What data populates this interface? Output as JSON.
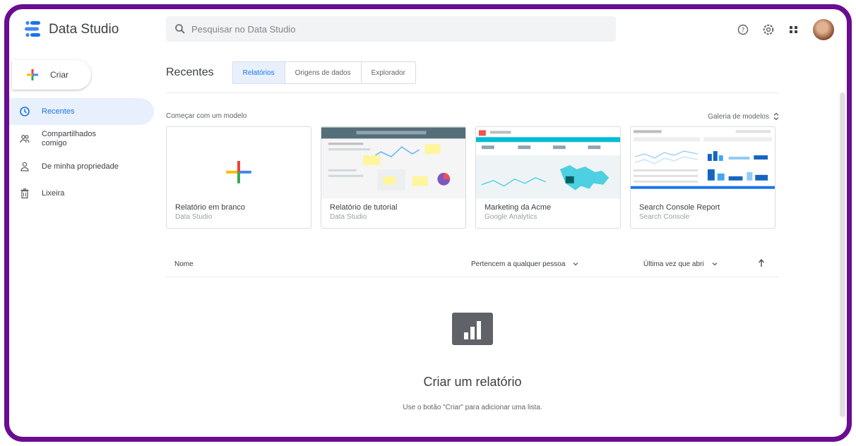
{
  "header": {
    "app_title": "Data Studio",
    "search_placeholder": "Pesquisar no Data Studio",
    "icons": [
      "help-icon",
      "settings-icon",
      "apps-grid-icon",
      "avatar"
    ]
  },
  "sidebar": {
    "create_label": "Criar",
    "items": [
      {
        "label": "Recentes",
        "icon": "clock-icon",
        "active": true
      },
      {
        "label": "Compartilhados comigo",
        "icon": "people-icon",
        "active": false
      },
      {
        "label": "De minha propriedade",
        "icon": "person-icon",
        "active": false
      },
      {
        "label": "Lixeira",
        "icon": "trash-icon",
        "active": false
      }
    ]
  },
  "main": {
    "section_title": "Recentes",
    "tabs": [
      {
        "label": "Relatórios",
        "active": true
      },
      {
        "label": "Origens de dados",
        "active": false
      },
      {
        "label": "Explorador",
        "active": false
      }
    ],
    "start_label": "Começar com um modelo",
    "gallery_label": "Galeria de modelos",
    "templates": [
      {
        "title": "Relatório em branco",
        "subtitle": "Data Studio"
      },
      {
        "title": "Relatório de tutorial",
        "subtitle": "Data Studio"
      },
      {
        "title": "Marketing da Acme",
        "subtitle": "Google Analytics"
      },
      {
        "title": "Search Console Report",
        "subtitle": "Search Console"
      }
    ],
    "list_header": {
      "name": "Nome",
      "owner": "Pertencem a qualquer pessoa",
      "opened": "Última vez que abri"
    },
    "empty_state": {
      "title": "Criar um relatório",
      "subtitle": "Use o botão \"Criar\" para adicionar uma lista."
    }
  },
  "colors": {
    "frame": "#6a0d91",
    "accent": "#1a73e8",
    "active_bg": "#e8f0fe"
  }
}
